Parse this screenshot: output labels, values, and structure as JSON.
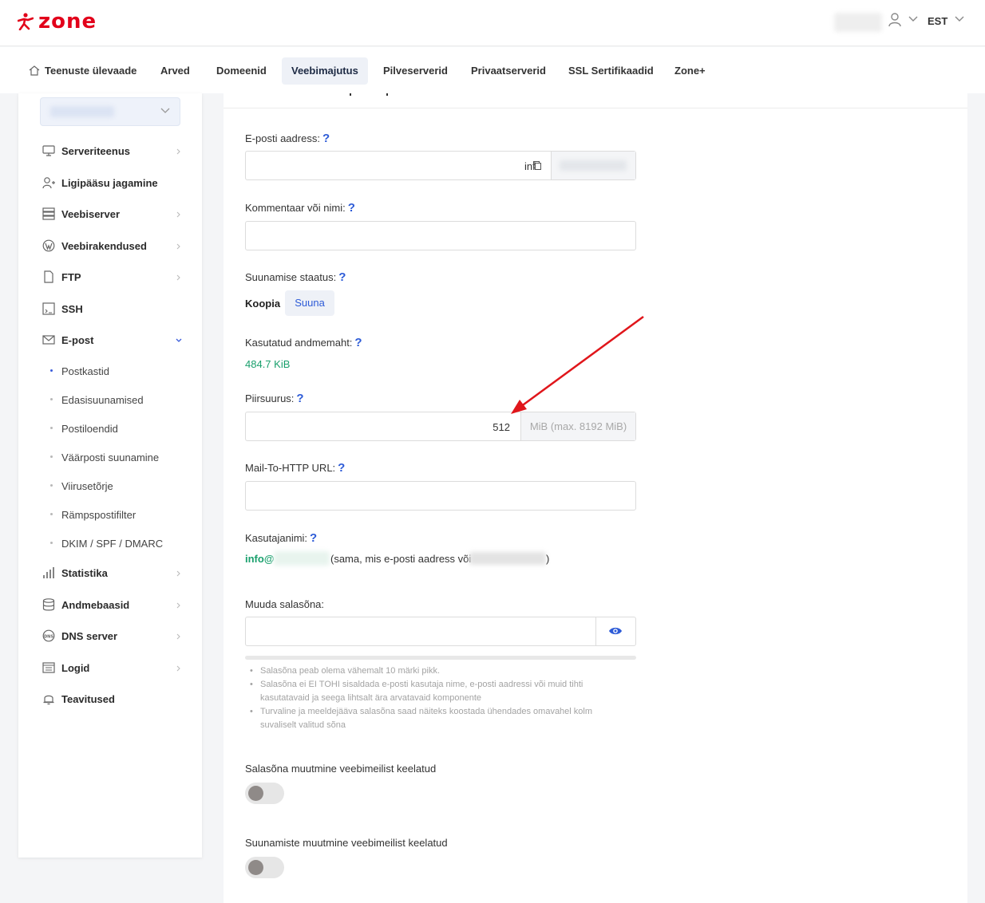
{
  "header": {
    "logo_text": "zone",
    "language": "EST"
  },
  "nav": {
    "items": [
      {
        "label": "Teenuste ülevaade"
      },
      {
        "label": "Arved"
      },
      {
        "label": "Domeenid"
      },
      {
        "label": "Veebimajutus",
        "active": true
      },
      {
        "label": "Pilveserverid"
      },
      {
        "label": "Privaatserverid"
      },
      {
        "label": "SSL Sertifikaadid"
      },
      {
        "label": "Zone+"
      }
    ]
  },
  "sidebar": {
    "items": [
      {
        "label": "Serveriteenus",
        "icon": "monitor-icon"
      },
      {
        "label": "Ligipääsu jagamine",
        "icon": "user-add-icon"
      },
      {
        "label": "Veebiserver",
        "icon": "server-icon"
      },
      {
        "label": "Veebirakendused",
        "icon": "wordpress-icon"
      },
      {
        "label": "FTP",
        "icon": "file-icon"
      },
      {
        "label": "SSH",
        "icon": "terminal-icon"
      },
      {
        "label": "E-post",
        "icon": "mail-icon"
      },
      {
        "label": "Statistika",
        "icon": "bar-chart-icon"
      },
      {
        "label": "Andmebaasid",
        "icon": "database-icon"
      },
      {
        "label": "DNS server",
        "icon": "dns-icon"
      },
      {
        "label": "Logid",
        "icon": "log-icon"
      },
      {
        "label": "Teavitused",
        "icon": "bell-icon"
      }
    ],
    "email_subitems": [
      {
        "label": "Postkastid",
        "active": true
      },
      {
        "label": "Edasisuunamised"
      },
      {
        "label": "Postiloendid"
      },
      {
        "label": "Väärposti suunamine"
      },
      {
        "label": "Viirusetõrje"
      },
      {
        "label": "Rämpspostifilter"
      },
      {
        "label": "DKIM / SPF / DMARC"
      }
    ]
  },
  "form": {
    "email_label": "E-posti aadress:",
    "email_value": "info",
    "comment_label": "Kommentaar või nimi:",
    "comment_value": "",
    "forward_status_label": "Suunamise staatus:",
    "forward_copy": "Koopia",
    "forward_direct": "Suuna",
    "used_label": "Kasutatud andmemaht:",
    "used_value": "484.7 KiB",
    "quota_label": "Piirsuurus:",
    "quota_value": "512",
    "quota_unit": "MiB (max. 8192 MiB)",
    "mail_http_label": "Mail-To-HTTP URL:",
    "mail_http_value": "",
    "username_label": "Kasutajanimi:",
    "username_value": "info@",
    "username_note_prefix": "(sama, mis e-posti aadress või",
    "username_note_suffix": ")",
    "password_label": "Muuda salasõna:",
    "password_value": "",
    "password_hints": [
      "Salasõna peab olema vähemalt 10 märki pikk.",
      "Salasõna ei EI TOHI sisaldada e-posti kasutaja nime, e-posti aadressi või muid tihti kasutatavaid ja seega lihtsalt ära arvatavaid komponente",
      "Turvaline ja meeldejääva salasõna saad näiteks koostada ühendades omavahel kolm suvaliselt valitud sõna"
    ],
    "webmail_password_label": "Salasõna muutmine veebimeilist keelatud",
    "webmail_password_on": false,
    "webmail_forward_label": "Suunamiste muutmine veebimeilist keelatud",
    "webmail_forward_on": false
  },
  "colors": {
    "brand": "#e2001a",
    "link": "#2d5bd7",
    "success": "#1aa06d",
    "arrow": "#e0161b"
  }
}
